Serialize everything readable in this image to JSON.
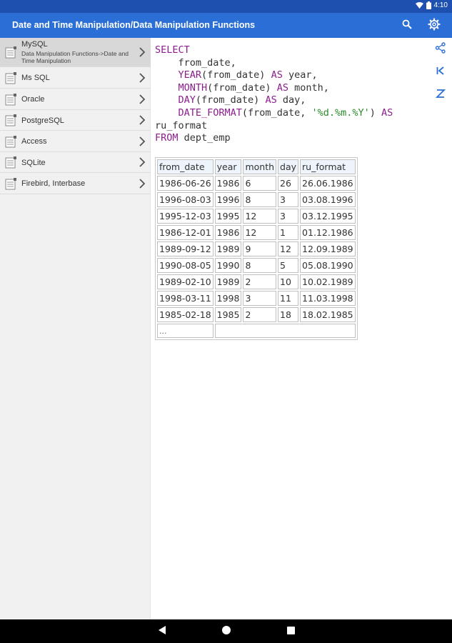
{
  "status": {
    "time": "4:10"
  },
  "appbar": {
    "title": "Date and Time Manipulation/Data Manipulation Functions"
  },
  "sidebar": {
    "items": [
      {
        "label": "MySQL",
        "sub": "Data Manipulation Functions->Date and Time Manipulation",
        "active": true
      },
      {
        "label": "Ms SQL"
      },
      {
        "label": "Oracle"
      },
      {
        "label": "PostgreSQL"
      },
      {
        "label": "Access"
      },
      {
        "label": "SQLite"
      },
      {
        "label": "Firebird, Interbase"
      }
    ]
  },
  "code": {
    "l1_kw": "SELECT",
    "l2_text": "    from_date,",
    "l3_kw": "YEAR",
    "l3_text": "(from_date) ",
    "l3_kw2": "AS",
    "l3_alias": " year,",
    "l4_kw": "MONTH",
    "l4_text": "(from_date) ",
    "l4_kw2": "AS",
    "l4_alias": " month,",
    "l5_kw": "DAY",
    "l5_text": "(from_date) ",
    "l5_kw2": "AS",
    "l5_alias": " day,",
    "l6_kw": "DATE_FORMAT",
    "l6_text": "(from_date, ",
    "l6_str": "'%d.%m.%Y'",
    "l6_text2": ") ",
    "l6_kw2": "AS",
    "l7_text": "ru_format",
    "l8_kw": "FROM",
    "l8_text": " dept_emp"
  },
  "table": {
    "headers": [
      "from_date",
      "year",
      "month",
      "day",
      "ru_format"
    ],
    "rows": [
      [
        "1986-06-26",
        "1986",
        "6",
        "26",
        "26.06.1986"
      ],
      [
        "1996-08-03",
        "1996",
        "8",
        "3",
        "03.08.1996"
      ],
      [
        "1995-12-03",
        "1995",
        "12",
        "3",
        "03.12.1995"
      ],
      [
        "1986-12-01",
        "1986",
        "12",
        "1",
        "01.12.1986"
      ],
      [
        "1989-09-12",
        "1989",
        "9",
        "12",
        "12.09.1989"
      ],
      [
        "1990-08-05",
        "1990",
        "8",
        "5",
        "05.08.1990"
      ],
      [
        "1989-02-10",
        "1989",
        "2",
        "10",
        "10.02.1989"
      ],
      [
        "1998-03-11",
        "1998",
        "3",
        "11",
        "11.03.1998"
      ],
      [
        "1985-02-18",
        "1985",
        "2",
        "18",
        "18.02.1985"
      ]
    ],
    "more": "..."
  },
  "icons": {
    "wifi": "wifi-icon",
    "battery": "battery-icon",
    "search": "search-icon",
    "settings": "gear-icon",
    "share": "share-icon",
    "first": "first-page-icon",
    "sort": "sort-icon",
    "back": "back-icon",
    "home": "home-icon",
    "recents": "recents-icon",
    "db": "database-icon",
    "chevron": "chevron-right-icon"
  },
  "colors": {
    "statusbar": "#1e50b0",
    "appbar": "#2b6fd6",
    "keyword": "#8b1e8b",
    "string": "#2a8a2a"
  }
}
